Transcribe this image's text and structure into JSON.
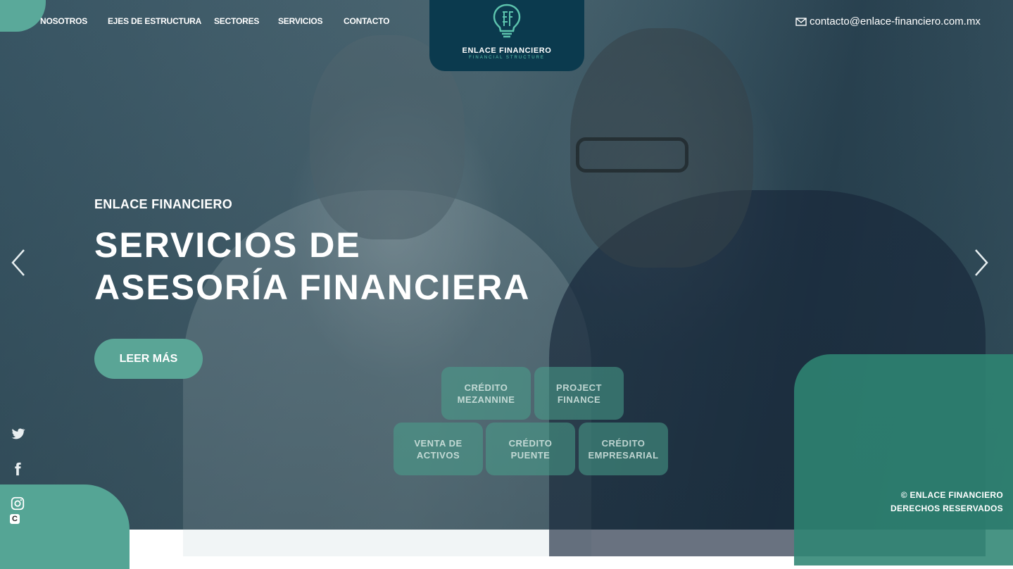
{
  "nav": {
    "items": [
      "NOSOTROS",
      "EJES DE ESTRUCTURA",
      "SECTORES",
      "SERVICIOS",
      "CONTACTO"
    ]
  },
  "logo": {
    "name": "ENLACE FINANCIERO",
    "tagline": "FINANCIAL STRUCTURE",
    "icon": "lightbulb-ef-icon"
  },
  "contact": {
    "icon": "mail-icon",
    "email": "contacto@enlace-financiero.com.mx"
  },
  "hero": {
    "eyebrow": "ENLACE FINANCIERO",
    "title_line1": "SERVICIOS DE",
    "title_line2": "ASESORÍA FINANCIERA",
    "cta_label": "LEER MÁS",
    "prev_icon": "chevron-left-icon",
    "next_icon": "chevron-right-icon"
  },
  "tiles": [
    {
      "label": "CRÉDITO\nMEZANNINE"
    },
    {
      "label": "PROJECT\nFINANCE"
    },
    {
      "label": "VENTA DE\nACTIVOS"
    },
    {
      "label": "CRÉDITO\nPUENTE"
    },
    {
      "label": "CRÉDITO\nEMPRESARIAL"
    }
  ],
  "social": [
    "twitter-icon",
    "facebook-icon",
    "instagram-icon"
  ],
  "footer": {
    "line1": "© ENLACE FINANCIERO",
    "line2": "DERECHOS RESERVADOS"
  },
  "colors": {
    "teal": "#5aa596",
    "navy": "#0b3a4e",
    "accent_green": "#5cc3ad"
  }
}
